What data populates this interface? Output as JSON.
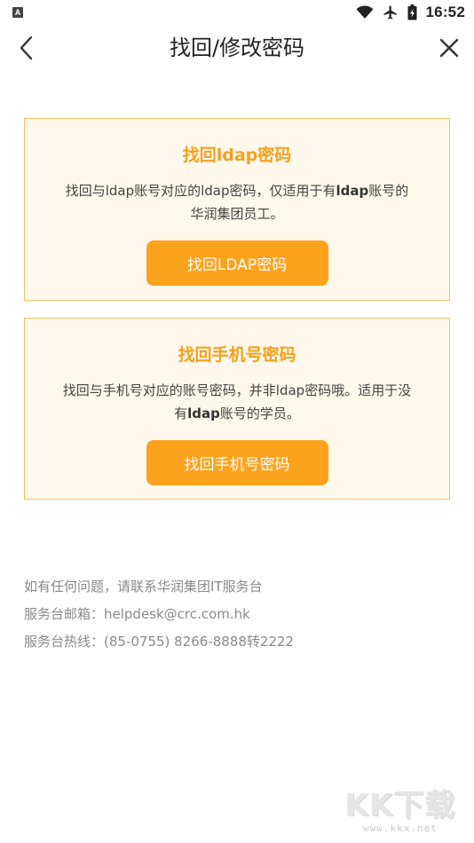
{
  "status_bar": {
    "time": "16:52",
    "app_icon_letter": "A",
    "icons": [
      "wifi-icon",
      "airplane-icon",
      "battery-icon"
    ]
  },
  "header": {
    "title": "找回/修改密码",
    "back_icon": "chevron-left-icon",
    "close_icon": "close-icon"
  },
  "cards": [
    {
      "title": "找回ldap密码",
      "desc_part1": "找回与ldap账号对应的ldap密码，仅适用于有",
      "desc_bold": "ldap",
      "desc_part2": "账号的华润集团员工。",
      "button_label": "找回LDAP密码"
    },
    {
      "title": "找回手机号密码",
      "desc_part1": "找回与手机号对应的账号密码，并非ldap密码哦。适用于没有",
      "desc_bold": "ldap",
      "desc_part2": "账号的学员。",
      "button_label": "找回手机号密码"
    }
  ],
  "contact": {
    "line1": "如有任何问题，请联系华润集团IT服务台",
    "line2": "服务台邮箱：helpdesk@crc.com.hk",
    "line3": "服务台热线：(85-0755) 8266-8888转2222"
  },
  "watermark": {
    "logo": "KK下载",
    "url": "www.kkx.net"
  },
  "colors": {
    "accent": "#fda21d",
    "card_bg": "#fff8ec",
    "card_border": "#f7be6a",
    "title_orange": "#f5a11d"
  }
}
